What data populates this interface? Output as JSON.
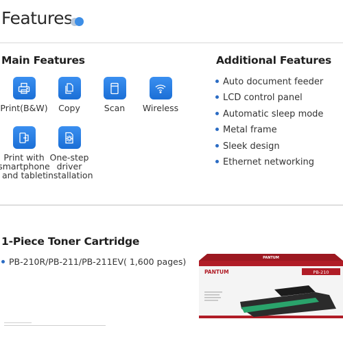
{
  "page": {
    "title": "Features",
    "accent": "#3d8ee6"
  },
  "main_features": {
    "heading": "Main Features",
    "items": [
      {
        "icon": "printer-icon",
        "label": "Print(B&W)"
      },
      {
        "icon": "copy-icon",
        "label": "Copy"
      },
      {
        "icon": "scan-icon",
        "label": "Scan"
      },
      {
        "icon": "wifi-icon",
        "label": "Wireless"
      },
      {
        "icon": "mobile-print-icon",
        "label": "Print with smartphone and tablet"
      },
      {
        "icon": "driver-gear-icon",
        "label": "One-step driver installation"
      }
    ]
  },
  "additional_features": {
    "heading": "Additional Features",
    "items": [
      "Auto document feeder",
      "LCD control panel",
      "Automatic sleep mode",
      "Metal frame",
      "Sleek design",
      "Ethernet networking"
    ]
  },
  "toner": {
    "heading": "1-Piece Toner Cartridge",
    "item": "PB-210R/PB-211/PB-211EV( 1,600 pages)",
    "box_brand": "PANTUM",
    "box_model": "PB-210",
    "brand_color": "#b01c26"
  }
}
